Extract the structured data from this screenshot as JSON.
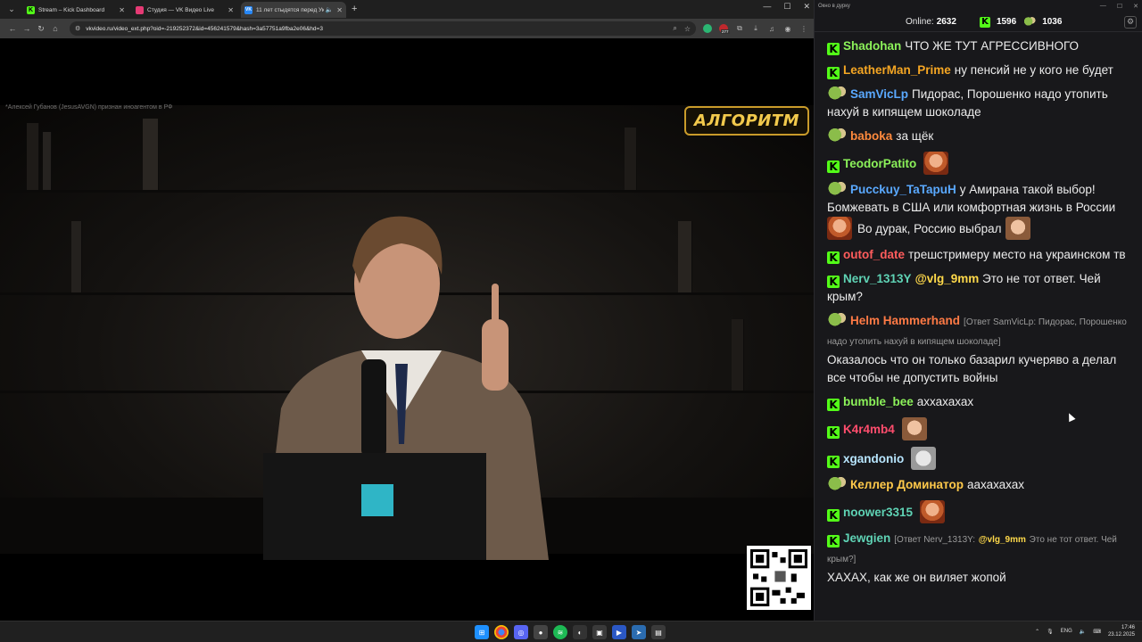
{
  "browser": {
    "tabs": [
      {
        "title": "Stream – Kick Dashboard",
        "favicon_color": "#53fc18",
        "favicon_glyph": "K",
        "active": false
      },
      {
        "title": "Студия — VK Видео Live",
        "favicon_color": "#e53a74",
        "favicon_glyph": "",
        "active": false
      },
      {
        "title": "11 лет стыдятся перед Укр",
        "favicon_color": "#2787f5",
        "favicon_glyph": "VK",
        "active": true
      }
    ],
    "new_tab_icon": "plus-icon",
    "address": {
      "url": "vkvideo.ru/video_ext.php?oid=-219252372&id=456241579&hash=3a57751a9fba2e06&hd=3"
    },
    "extension_badge": "277"
  },
  "video": {
    "watermark": "*Алексей Губанов (JesusAVGN) признан иноагентом в РФ",
    "logo_text": "АЛГОРИТМ"
  },
  "chat_window": {
    "title": "Окно в дурку",
    "online_label": "Online:",
    "online_count": "2632",
    "kick_count": "1596",
    "other_count": "1036"
  },
  "chat": {
    "messages": [
      {
        "badge": "kick",
        "user": "Shadohan",
        "color": "#8cf25a",
        "text": "ЧТО ЖЕ ТУТ АГРЕССИВНОГО"
      },
      {
        "badge": "kick",
        "user": "LeatherMan_Prime",
        "color": "#f5a623",
        "text": "ну пенсий не у кого не будет"
      },
      {
        "badge": "pepe",
        "user": "SamVicLp",
        "color": "#5aa9ff",
        "text": "Пидорас, Порошенко надо утопить нахуй в кипящем шоколаде"
      },
      {
        "badge": "pepe",
        "user": "baboka",
        "color": "#ff8a3d",
        "text": "за щёк"
      },
      {
        "badge": "kick",
        "user": "TeodorPatito",
        "color": "#8cf25a",
        "text": "",
        "emote": "face1"
      },
      {
        "badge": "pepe",
        "user": "Pucckuy_TaTapuH",
        "color": "#5aa9ff",
        "text": "у Амирана такой выбор! Бомжевать в США или комфортная жизнь в России",
        "emote_line": "Во дурак, Россию выбрал"
      },
      {
        "badge": "kick",
        "user": "outof_date",
        "color": "#ff5c5c",
        "text": "трешстримеру место на украинском тв"
      },
      {
        "badge": "kick",
        "user": "Nerv_1313Y",
        "color": "#5fd3b5",
        "mention": "@vlg_9mm",
        "text": "Это не тот ответ. Чей крым?"
      },
      {
        "badge": "pepe",
        "user": "Helm Hammerhand",
        "color": "#ff7a45",
        "reply": "[Ответ SamVicLp: Пидорас, Порошенко надо утопить нахуй в кипящем шоколаде]",
        "text": "Оказалось что он только базарил кучеряво а делал все чтобы не допустить войны"
      },
      {
        "badge": "kick",
        "user": "bumble_bee",
        "color": "#8cf25a",
        "text": "аххахахах"
      },
      {
        "badge": "kick",
        "user": "K4r4mb4",
        "color": "#ff4d6d",
        "text": "",
        "emote": "face2"
      },
      {
        "badge": "kick",
        "user": "xgandonio",
        "color": "#b8e6ff",
        "text": "",
        "emote": "cat"
      },
      {
        "badge": "pepe",
        "user": "Келлер Доминатор",
        "color": "#ffc94a",
        "text": "аахахахах"
      },
      {
        "badge": "kick",
        "user": "noower3315",
        "color": "#5fd3b5",
        "text": "",
        "emote": "face1"
      },
      {
        "badge": "kick",
        "user": "Jewgien",
        "color": "#5fd3b5",
        "reply": "[Ответ Nerv_1313Y:",
        "reply_mention": "@vlg_9mm",
        "reply_tail": "Это не тот ответ. Чей крым?]",
        "text": "ХАХАХ, как же он виляет жопой"
      }
    ]
  },
  "taskbar": {
    "lang": "ENG",
    "time": "17:46",
    "date": "23.12.2025"
  }
}
